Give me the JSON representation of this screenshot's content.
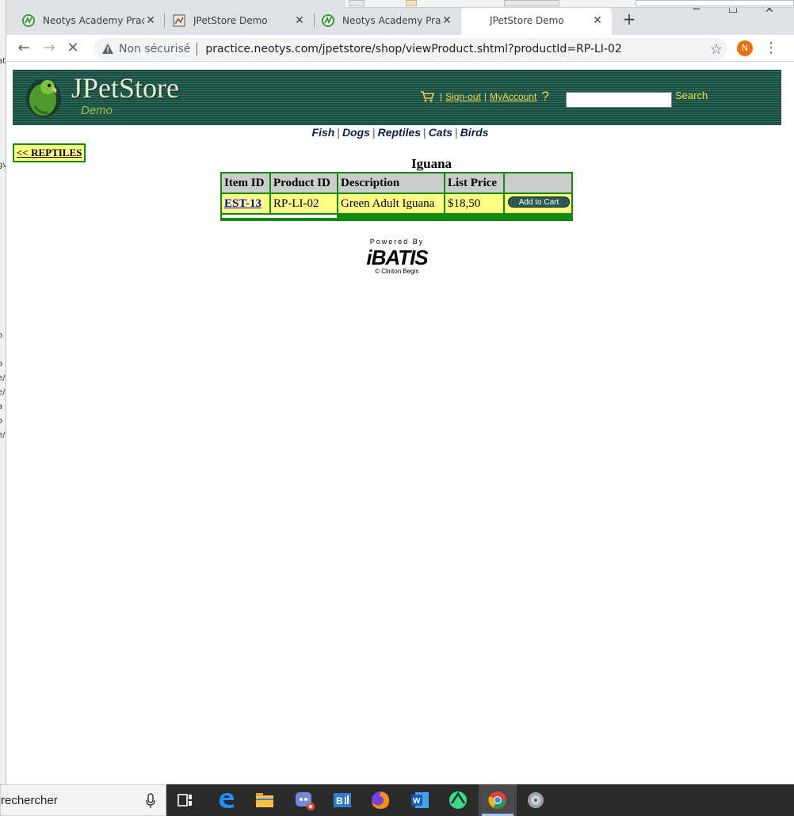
{
  "browser": {
    "tabs": [
      {
        "label": "Neotys Academy Practi",
        "icon": "neotys-icon",
        "active": false
      },
      {
        "label": "JPetStore Demo",
        "icon": "jpetstore-page-icon",
        "active": false
      },
      {
        "label": "Neotys Academy Practi",
        "icon": "neotys-icon",
        "active": false
      },
      {
        "label": "JPetStore Demo",
        "icon": "none",
        "active": true
      }
    ],
    "new_tab": "+",
    "window_controls": {
      "minimize": "─",
      "maximize": "☐",
      "close": "✕"
    },
    "nav": {
      "back": "←",
      "forward": "→",
      "reload": "✕"
    },
    "security_label": "Non sécurisé",
    "url": "practice.neotys.com/jpetstore/shop/viewProduct.shtml?productId=RP-LI-02",
    "profile_initial": "N"
  },
  "site": {
    "logo_title": "JPetStore",
    "logo_subtitle": "Demo",
    "menu": {
      "sign_out": "Sign-out",
      "my_account": "MyAccount",
      "help": "?",
      "separator": "|"
    },
    "search": {
      "value": "",
      "button": "Search"
    },
    "quicklinks": [
      "Fish",
      "Dogs",
      "Reptiles",
      "Cats",
      "Birds"
    ],
    "quicklinks_sep": "|",
    "colors": {
      "banner": "#1d4b3f",
      "accent": "#f0d84a",
      "table_border": "#0f8a0f",
      "row_bg": "#ffff88"
    }
  },
  "product": {
    "back_label": "<< REPTILES",
    "name": "Iguana",
    "columns": [
      "Item ID",
      "Product ID",
      "Description",
      "List Price",
      ""
    ],
    "items": [
      {
        "item_id": "EST-13",
        "product_id": "RP-LI-02",
        "description": "Green Adult Iguana",
        "price": "$18,50",
        "action": "Add to Cart"
      }
    ]
  },
  "footer": {
    "powered_by": "Powered By",
    "brand": "iBATIS",
    "credit": "© Clinton Begin"
  },
  "taskbar": {
    "search_text": "rechercher",
    "apps": [
      "task-view-icon",
      "edge-icon",
      "file-explorer-icon",
      "discord-icon",
      "bi-icon",
      "firefox-icon",
      "word-icon",
      "android-studio-icon",
      "chrome-icon",
      "media-app-icon"
    ]
  },
  "behind_window_fragments": [
    "at",
    "gv",
    "o",
    "o",
    "e/",
    "e/",
    "a li",
    "o",
    "e/"
  ]
}
